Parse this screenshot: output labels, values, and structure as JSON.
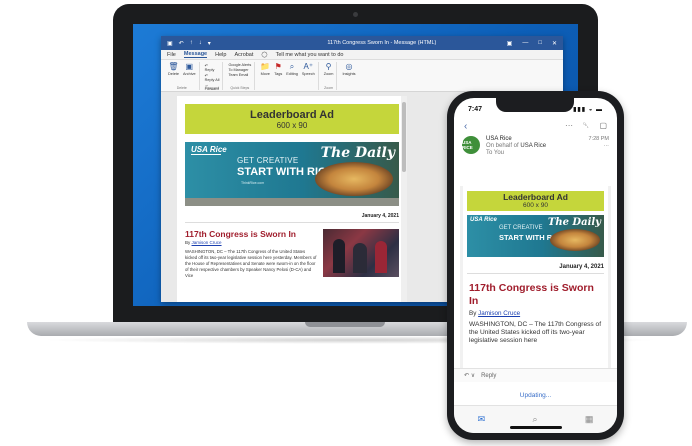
{
  "outlook": {
    "title": "117th Congress Sworn In  -  Message (HTML)",
    "quick_access": [
      "▣",
      "↶",
      "↑",
      "↓",
      "▾"
    ],
    "window_controls": [
      "▣",
      "—",
      "□",
      "✕"
    ],
    "menu": [
      "File",
      "Message",
      "Help",
      "Acrobat"
    ],
    "menu_active": "Message",
    "tell_me": "Tell me what you want to do",
    "ribbon": {
      "delete": {
        "label1": "Delete",
        "label2": "Archive",
        "group": "Delete"
      },
      "respond": {
        "reply": "Reply",
        "reply_all": "Reply All",
        "forward": "Forward",
        "group": "Respond"
      },
      "quick_steps": {
        "items": [
          "Google Alerts",
          "To Manager",
          "Team Email"
        ],
        "group": "Quick Steps"
      },
      "move": "Move",
      "tags": "Tags",
      "editing": "Editing",
      "speech": "Speech",
      "zoom": {
        "label": "Zoom",
        "group": "Zoom"
      },
      "insights": "Insights"
    }
  },
  "email": {
    "ad": {
      "line1": "Leaderboard Ad",
      "line2": "600 x 90"
    },
    "banner": {
      "brand": "USA Rice",
      "tagline1": "GET CREATIVE",
      "tagline2": "START WITH RICE",
      "url": "ThinkRice.com",
      "series": "The Daily"
    },
    "date": "January 4, 2021",
    "headline": "117th Congress is Sworn In",
    "byline_prefix": "By",
    "author": "Jamison Cruce",
    "body": "WASHINGTON, DC – The 117th Congress of the United States kicked off its two-year legislative session here yesterday. Members of the House of Representatives and Senate were sworn-in on the floor of their respective chambers by Speaker Nancy Pelosi (D-CA) and Vice"
  },
  "phone": {
    "time": "7:47",
    "status_icons": "▮▮▮ ◒ ▬",
    "back_icon": "‹",
    "toolbar_icons": [
      "···",
      "␡",
      "▢"
    ],
    "sender": {
      "avatar": "USA RICE",
      "name": "USA Rice",
      "on_behalf": "On behalf of",
      "on_behalf_name": "USA Rice",
      "to": "To You",
      "time": "7:28 PM",
      "more": "···"
    },
    "ad": {
      "line1": "Leaderboard Ad",
      "line2": "600 x 90"
    },
    "banner": {
      "brand": "USA Rice",
      "tagline1": "GET CREATIVE",
      "tagline2": "START WITH RICE",
      "series": "The Daily"
    },
    "date": "January 4, 2021",
    "headline": "117th Congress is Sworn In",
    "byline_prefix": "By",
    "author": "Jamison Cruce",
    "body": "WASHINGTON, DC – The 117th Congress of the United States kicked off its two-year legislative session here",
    "reply_icon": "↶ ∨",
    "reply": "Reply",
    "updating": "Updating...",
    "nav_icons": [
      "✉",
      "⌕",
      "▦"
    ]
  },
  "colors": {
    "outlook_blue": "#2b579a",
    "ad_green": "#c5d63b",
    "headline_red": "#a01d2c",
    "desktop_blue": "#1d7bd6"
  }
}
